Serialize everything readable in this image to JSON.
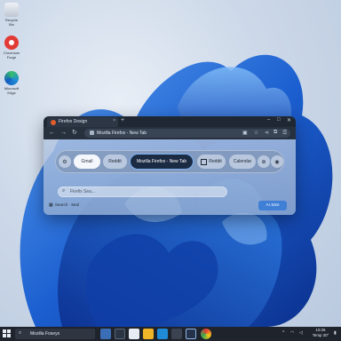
{
  "desktop": {
    "icons": [
      {
        "name": "recycle-bin-icon",
        "label_line1": "Recycle",
        "label_line2": "Bin",
        "color": "#d9dee7"
      },
      {
        "name": "chrome-icon",
        "label_line1": "Chromium",
        "label_line2": "Forge",
        "color": "#e23b35"
      },
      {
        "name": "edge-icon",
        "label_line1": "Microsoft",
        "label_line2": "Edge",
        "color": "#1f8bd6"
      }
    ]
  },
  "browser": {
    "tab_title": "Firefox Design",
    "tab_close": "×",
    "new_tab": "+",
    "url_text": "Mozilla Firefox - New Tab",
    "window_controls": {
      "minimize": "–",
      "maximize": "□",
      "close": "✕"
    },
    "nav": {
      "back": "←",
      "forward": "→",
      "reload": "↻"
    },
    "toolbar": {
      "star": "☆",
      "share": "⋖",
      "extension": "⧉",
      "menu": "☰"
    }
  },
  "newtab": {
    "chips": {
      "gmail": "Gmail",
      "reddit": "Reddit",
      "active": "Mozilla Firefox - New Tab",
      "reddit2": "Reddit",
      "calendar": "Calendar"
    },
    "search_placeholder": "Firefix Sea...",
    "footer_text": "Search · Mail",
    "ai_button": "AI Size"
  },
  "taskbar": {
    "search_text": "Mozilla Foseys",
    "clock_time": "10:26",
    "clock_date": "Temp 30°",
    "accent": "#3f7fd6"
  }
}
